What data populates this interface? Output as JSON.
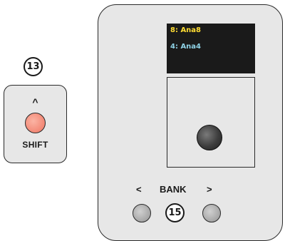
{
  "shift_section": {
    "callout": "13",
    "caret": "^",
    "label": "SHIFT"
  },
  "display": {
    "line1": "8: Ana8",
    "line2": "4: Ana4",
    "line1_color": "#ffdd33",
    "line2_color": "#8fd2e6"
  },
  "bank": {
    "prev": "<",
    "label": "BANK",
    "next": ">",
    "callout": "15"
  },
  "colors": {
    "panel": "#e7e7e7",
    "shift_led": "#f48e7c",
    "bank_buttons": "#a6a6a6",
    "encoder_knob": "#3d3d3d"
  }
}
